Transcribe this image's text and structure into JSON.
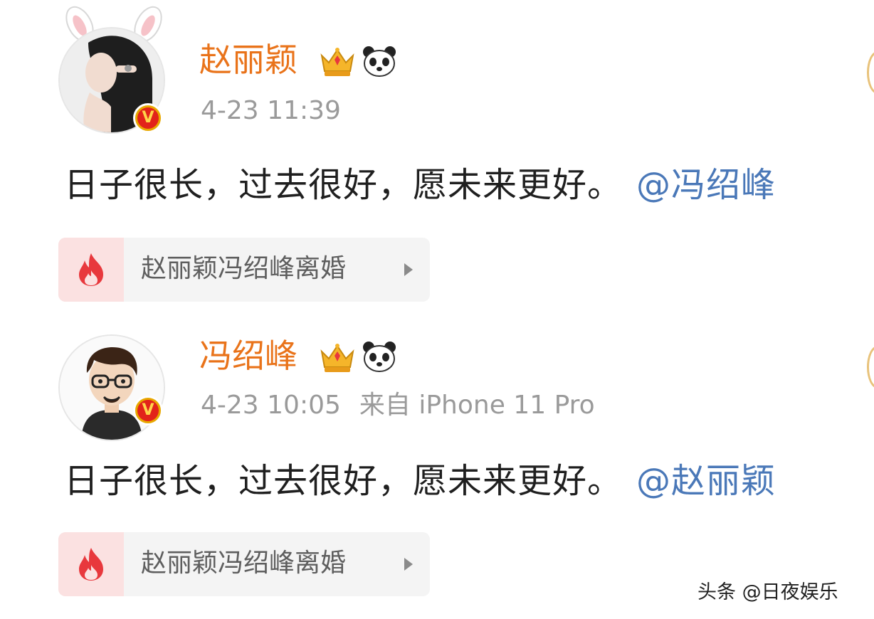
{
  "posts": [
    {
      "username": "赵丽颖",
      "time": "4-23 11:39",
      "source": "",
      "text": "日子很长，过去很好，愿未来更好。",
      "mention": "@冯绍峰",
      "topic": "赵丽颖冯绍峰离婚"
    },
    {
      "username": "冯绍峰",
      "time": "4-23 10:05",
      "source": "来自 iPhone 11 Pro",
      "text": "日子很长，过去很好，愿未来更好。",
      "mention": "@赵丽颖",
      "topic": "赵丽颖冯绍峰离婚"
    }
  ],
  "watermark": "头条 @日夜娱乐",
  "colors": {
    "username": "#e9731a",
    "mention": "#4a78b8",
    "meta": "#9a9a9a",
    "topic_bg": "#f4f4f4",
    "fire": "#e8383d",
    "verified_badge": "#e2231a"
  },
  "icons": {
    "verified": "verified-v-icon",
    "crown": "crown-icon",
    "panda": "panda-icon",
    "topic": "fire-icon",
    "topic_arrow": "play-arrow-icon"
  }
}
